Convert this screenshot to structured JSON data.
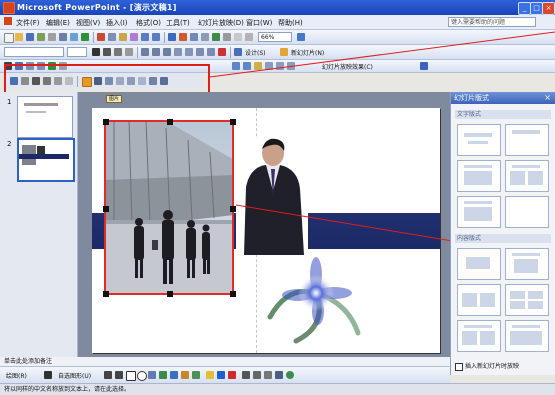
{
  "window": {
    "title": "Microsoft PowerPoint - [演示文稿1]",
    "minimize": "_",
    "maximize": "□",
    "close": "×"
  },
  "menus": [
    "文件(F)",
    "编辑(E)",
    "视图(V)",
    "插入(I)",
    "格式(O)",
    "工具(T)",
    "幻灯片放映(D)",
    "窗口(W)",
    "帮助(H)"
  ],
  "help_box": "键入需要帮助的问题",
  "toolbar_std": {
    "zoom": "66%"
  },
  "toolbar_fmt": {
    "design_label": "设计(S)",
    "new_slide_label": "新幻灯片(N)"
  },
  "toolbar_3": {
    "label": "幻灯片放映效果(C)"
  },
  "badge": "图片",
  "thumbs": [
    "1",
    "2"
  ],
  "taskpane": {
    "title": "幻灯片版式",
    "section_text": "文字版式",
    "section_content": "内容版式",
    "checkbox_label": "插入新幻灯片时放映"
  },
  "notes": "单击此处添加备注",
  "drawing": {
    "draw_label": "绘图(R)",
    "autoshape_label": "自选图形(U)"
  },
  "status": "将以同样的中文名称放到文本上，请在此选择。",
  "colors": {
    "highlight": "#e01d1d",
    "slide_band": "#1b2a66",
    "title_bar": "#2f62d9"
  }
}
